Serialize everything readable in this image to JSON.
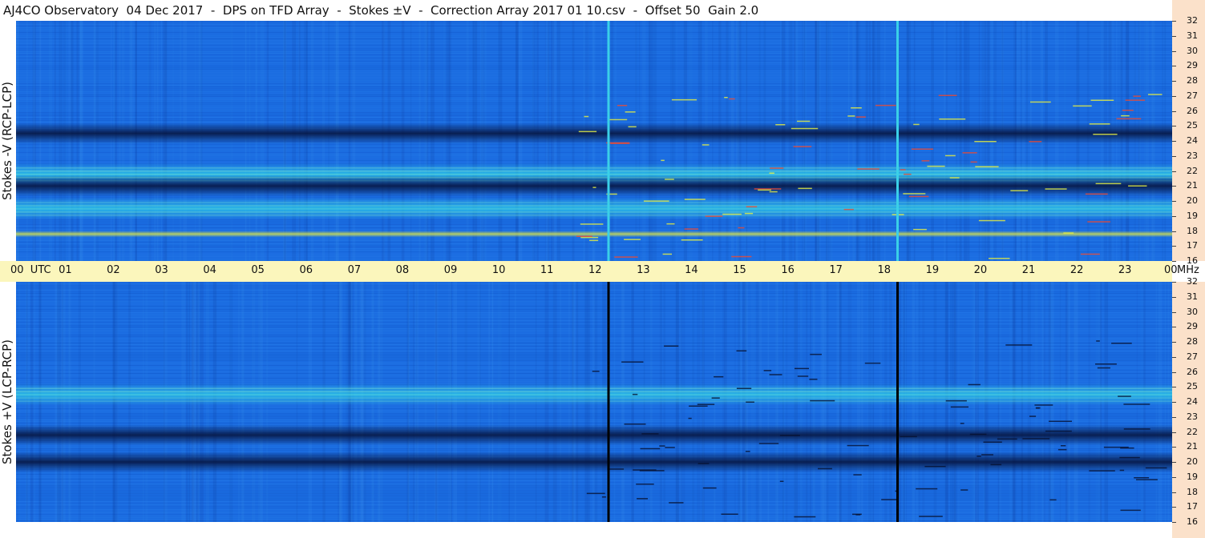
{
  "title": "AJ4CO Observatory  04 Dec 2017  -  DPS on TFD Array  -  Stokes ±V  -  Correction Array 2017 01 10.csv  -  Offset 50  Gain 2.0",
  "chart_data": [
    {
      "type": "heatmap",
      "name": "top",
      "ylabel": "Stokes -V (RCP-LCP)",
      "x_unit": "UTC",
      "y_unit": "MHz",
      "xlim": [
        0,
        24
      ],
      "ylim": [
        16,
        32
      ],
      "y_ticks": [
        "32",
        "31",
        "30",
        "29",
        "28",
        "27",
        "26",
        "25",
        "24",
        "23",
        "22",
        "21",
        "20",
        "19",
        "18",
        "17",
        "16"
      ],
      "colormap": "blue-cyan-yellow-red",
      "bands": [
        {
          "freq": 24.5,
          "level": "dark"
        },
        {
          "freq": 21.8,
          "level": "bright"
        },
        {
          "freq": 21.0,
          "level": "dark"
        },
        {
          "freq": 19.5,
          "level": "bright"
        },
        {
          "freq": 17.8,
          "level": "hot"
        }
      ],
      "vertical_lines_utc": [
        12.3,
        18.3
      ]
    },
    {
      "type": "heatmap",
      "name": "bottom",
      "ylabel": "Stokes +V (LCP-RCP)",
      "x_unit": "UTC",
      "y_unit": "MHz",
      "xlim": [
        0,
        24
      ],
      "ylim": [
        16,
        32
      ],
      "y_ticks": [
        "32",
        "31",
        "30",
        "29",
        "28",
        "27",
        "26",
        "25",
        "24",
        "23",
        "22",
        "21",
        "20",
        "19",
        "18",
        "17",
        "16"
      ],
      "colormap": "blue-cyan-yellow-red",
      "bands": [
        {
          "freq": 24.5,
          "level": "bright"
        },
        {
          "freq": 21.8,
          "level": "dark"
        },
        {
          "freq": 20.0,
          "level": "dark"
        }
      ],
      "vertical_lines_utc": [
        12.3,
        18.3
      ]
    }
  ],
  "time_axis": {
    "labels": [
      "00  UTC",
      "01",
      "02",
      "03",
      "04",
      "05",
      "06",
      "07",
      "08",
      "09",
      "10",
      "11",
      "12",
      "13",
      "14",
      "15",
      "16",
      "17",
      "18",
      "19",
      "20",
      "21",
      "22",
      "23",
      "00"
    ],
    "unit": "MHz"
  },
  "colors": {
    "background": "#1a6be0",
    "dark_band": "#06123a",
    "bright_band": "#2ec8e6",
    "hot": "#e8f040",
    "axis_bg": "#fbf6bc",
    "side_bg": "#fbe1ca"
  }
}
